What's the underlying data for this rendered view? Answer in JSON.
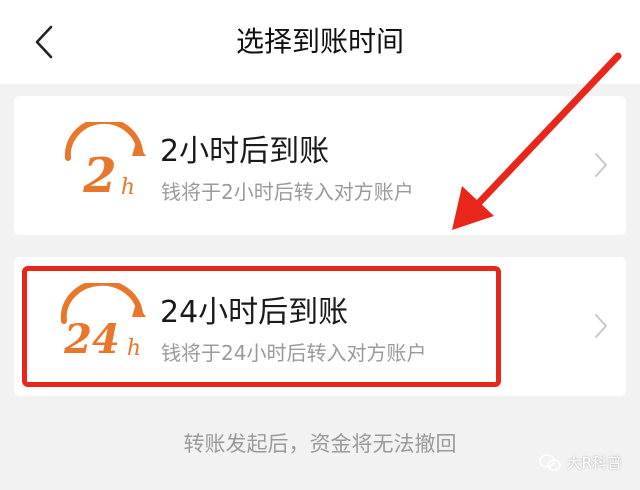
{
  "header": {
    "title": "选择到账时间",
    "back_icon": "chevron-left-icon"
  },
  "options": [
    {
      "logo_text": "2",
      "logo_unit": "h",
      "title": "2小时后到账",
      "description": "钱将于2小时后转入对方账户"
    },
    {
      "logo_text": "24",
      "logo_unit": "h",
      "title": "24小时后到账",
      "description": "钱将于24小时后转入对方账户"
    }
  ],
  "footer": {
    "note": "转账发起后，资金将无法撤回"
  },
  "watermark": {
    "text": "大R科普"
  },
  "colors": {
    "accent_orange": "#e9772b",
    "annotation_red": "#e8261c",
    "background": "#f2f2f2"
  }
}
